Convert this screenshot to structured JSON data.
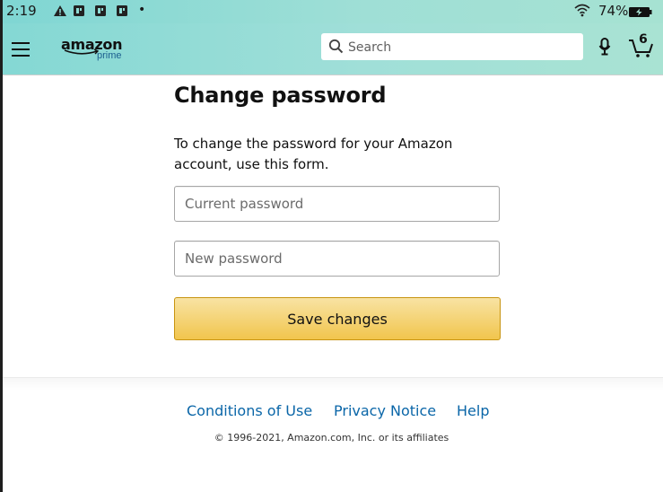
{
  "status_bar": {
    "time": "2:19",
    "battery_percent": "74%",
    "separator_dot": "•"
  },
  "header": {
    "logo_text": "amazon",
    "logo_sub": "prime",
    "search_placeholder": "Search",
    "cart_count": "6"
  },
  "main": {
    "title": "Change password",
    "description": "To change the password for your Amazon account, use this form.",
    "current_password_placeholder": "Current password",
    "new_password_placeholder": "New password",
    "save_label": "Save changes"
  },
  "footer": {
    "links": [
      "Conditions of Use",
      "Privacy Notice",
      "Help"
    ],
    "copyright": "© 1996-2021, Amazon.com, Inc. or its affiliates"
  },
  "colors": {
    "header_teal": "#8fdcd5",
    "button_yellow": "#f1c54d",
    "link_blue": "#0a66a8"
  }
}
